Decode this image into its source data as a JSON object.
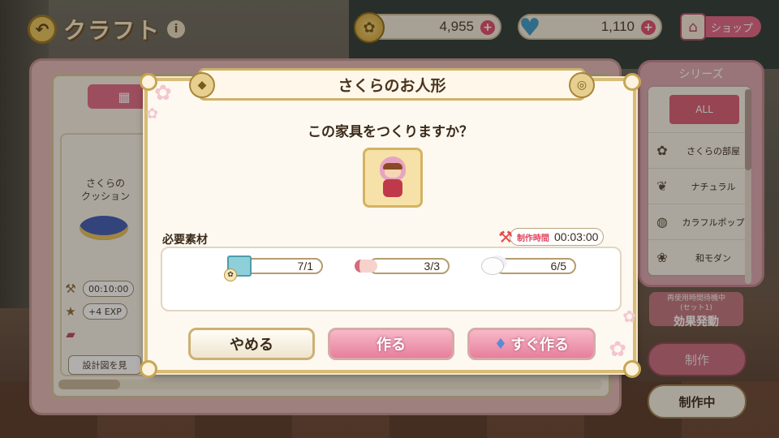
{
  "header": {
    "back_icon": "back-arrow-icon",
    "title": "クラフト",
    "info_label": "i"
  },
  "currency": {
    "coins": "4,955",
    "gems": "1,110",
    "plus": "+",
    "shop_label": "ショップ"
  },
  "left_panel": {
    "item_name": "さくらの\nクッション",
    "time": "00:10:00",
    "exp": "+4 EXP",
    "blueprint_button": "設計図を見"
  },
  "series": {
    "title": "シリーズ",
    "items": [
      {
        "label": "ALL"
      },
      {
        "label": "さくらの部屋",
        "icon": "sakura-room-icon"
      },
      {
        "label": "ナチュラル",
        "icon": "leaf-icon"
      },
      {
        "label": "カラフルポップ",
        "icon": "drum-icon"
      },
      {
        "label": "和モダン",
        "icon": "bonsai-icon"
      }
    ]
  },
  "side_buttons": {
    "effect_sub": "再使用時間待機中\n(セット1)",
    "effect_main": "効果発動",
    "make": "制作",
    "in_progress": "制作中"
  },
  "modal": {
    "title": "さくらのお人形",
    "question": "この家具をつくりますか？",
    "materials_label": "必要素材",
    "craft_time_label": "制作時間",
    "craft_time": "00:03:00",
    "materials": [
      {
        "name": "blueprint",
        "count": "7/1"
      },
      {
        "name": "cloth",
        "count": "3/3"
      },
      {
        "name": "cotton",
        "count": "6/5"
      }
    ],
    "buttons": {
      "cancel": "やめる",
      "make": "作る",
      "instant": "すぐ作る"
    }
  },
  "colors": {
    "accent_pink": "#e77f9c",
    "gold_border": "#d8bc78",
    "panel_bg": "#fdf9f0"
  }
}
